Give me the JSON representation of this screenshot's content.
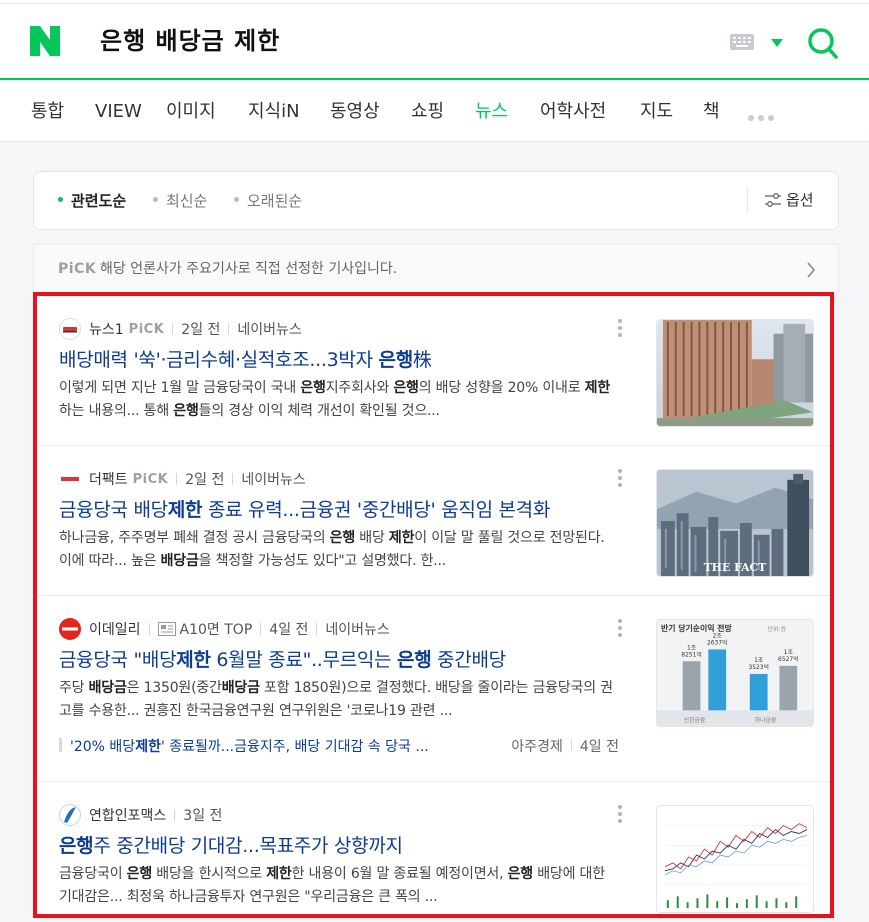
{
  "header": {
    "query": "은행 배당금 제한"
  },
  "tabs": [
    "통합",
    "VIEW",
    "이미지",
    "지식iN",
    "동영상",
    "쇼핑",
    "뉴스",
    "어학사전",
    "지도",
    "책"
  ],
  "active_tab": "뉴스",
  "sort": {
    "options": [
      "관련도순",
      "최신순",
      "오래된순"
    ],
    "active": "관련도순",
    "option_label": "옵션"
  },
  "pick_bar": {
    "tag": "PiCK",
    "text": "해당 언론사가 주요기사로 직접 선정한 기사입니다."
  },
  "articles": [
    {
      "press": "뉴스1",
      "pick": "PiCK",
      "time": "2일 전",
      "source": "네이버뉴스",
      "title_parts": [
        {
          "t": "배당매력 '쑥'·금리수혜·실적호조...3박자 ",
          "b": false
        },
        {
          "t": "은행",
          "b": true
        },
        {
          "t": "株",
          "b": false
        }
      ],
      "desc_parts": [
        {
          "t": "이렇게 되면 지난 1월 말 금융당국이 국내 ",
          "b": false
        },
        {
          "t": "은행",
          "b": true
        },
        {
          "t": "지주회사와 ",
          "b": false
        },
        {
          "t": "은행",
          "b": true
        },
        {
          "t": "의 배당 성향을 20% 이내로 ",
          "b": false
        },
        {
          "t": "제한",
          "b": true
        },
        {
          "t": "하는 내용의... 통해 ",
          "b": false
        },
        {
          "t": "은행",
          "b": true
        },
        {
          "t": "들의 경상 이익 체력 개선이 확인될 것으...",
          "b": false
        }
      ]
    },
    {
      "press": "더팩트",
      "pick": "PiCK",
      "time": "2일 전",
      "source": "네이버뉴스",
      "thumb_caption": "THE FACT",
      "title_parts": [
        {
          "t": "금융당국 배당",
          "b": false
        },
        {
          "t": "제한",
          "b": true
        },
        {
          "t": " 종료 유력...금융권 '중간배당' 움직임 본격화",
          "b": false
        }
      ],
      "desc_parts": [
        {
          "t": "하나금융, 주주명부 폐쇄 결정 공시 금융당국의 ",
          "b": false
        },
        {
          "t": "은행",
          "b": true
        },
        {
          "t": " 배당 ",
          "b": false
        },
        {
          "t": "제한",
          "b": true
        },
        {
          "t": "이 이달 말 풀릴 것으로 전망된다. 이에 따라... 높은 ",
          "b": false
        },
        {
          "t": "배당금",
          "b": true
        },
        {
          "t": "을 책정할 가능성도 있다\"고 설명했다. 한...",
          "b": false
        }
      ]
    },
    {
      "press": "이데일리",
      "paper": "A10면 TOP",
      "time": "4일 전",
      "source": "네이버뉴스",
      "title_parts": [
        {
          "t": "금융당국 \"배당",
          "b": false
        },
        {
          "t": "제한",
          "b": true
        },
        {
          "t": " 6월말 종료\"..무르익는 ",
          "b": false
        },
        {
          "t": "은행",
          "b": true
        },
        {
          "t": " 중간배당",
          "b": false
        }
      ],
      "desc_parts": [
        {
          "t": "주당 ",
          "b": false
        },
        {
          "t": "배당금",
          "b": true
        },
        {
          "t": "은 1350원(중간",
          "b": false
        },
        {
          "t": "배당금",
          "b": true
        },
        {
          "t": " 포함 1850원)으로 결정했다. 배당을 줄이라는 금융당국의 권고를 수용한... 권흥진 한국금융연구원 연구위원은 '코로나19 관련 ...",
          "b": false
        }
      ],
      "related": {
        "title_parts": [
          {
            "t": "'20% 배당",
            "b": false
          },
          {
            "t": "제한",
            "b": true
          },
          {
            "t": "' 종료될까...금융지주, 배당 기대감 속 당국 ...",
            "b": false
          }
        ],
        "press": "아주경제",
        "time": "4일 전"
      },
      "thumb": {
        "header": "반기 당기순이익 전망",
        "unit": "단위:원",
        "bars": [
          {
            "label": "2조\n2637억",
            "value": 22637
          },
          {
            "label": "1조\n8251억",
            "value": 18251
          },
          {
            "label": "1조\n3523억",
            "value": 13523
          },
          {
            "label": "1조\n6527억",
            "value": 16527
          }
        ],
        "groups": [
          "신한금융",
          "하나금융"
        ]
      }
    },
    {
      "press": "연합인포맥스",
      "time": "3일 전",
      "title_parts": [
        {
          "t": "은행",
          "b": true
        },
        {
          "t": "주 중간배당 기대감...목표주가 상향까지",
          "b": false
        }
      ],
      "desc_parts": [
        {
          "t": "금융당국이 ",
          "b": false
        },
        {
          "t": "은행",
          "b": true
        },
        {
          "t": " 배당을 한시적으로 ",
          "b": false
        },
        {
          "t": "제한",
          "b": true
        },
        {
          "t": "한 내용이 6월 말 종료될 예정이면서, ",
          "b": false
        },
        {
          "t": "은행",
          "b": true
        },
        {
          "t": " 배당에 대한 기대감은... 최정욱 하나금융투자 연구원은 \"우리금융은 큰 폭의 ...",
          "b": false
        }
      ]
    }
  ],
  "colors": {
    "naver_green": "#03c75a",
    "title_blue": "#0c3d91",
    "highlight_red": "#e8121c"
  }
}
